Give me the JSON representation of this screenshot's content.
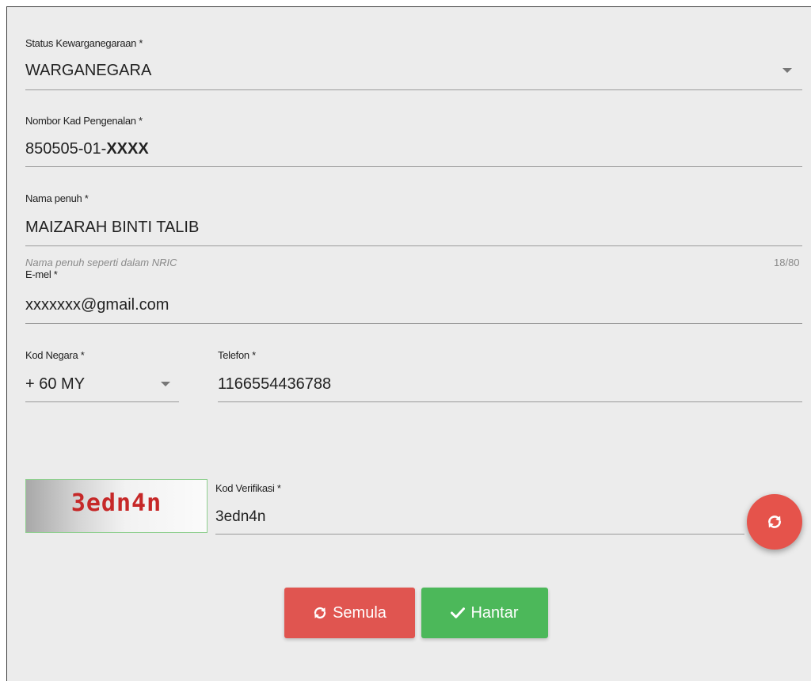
{
  "form": {
    "citizenship": {
      "label": "Status Kewarganegaraan *",
      "value": "WARGANEGARA"
    },
    "ic_number": {
      "label": "Nombor Kad Pengenalan *",
      "value_prefix": "850505-01-",
      "value_masked": "XXXX"
    },
    "full_name": {
      "label": "Nama penuh *",
      "value": "MAIZARAH BINTI TALIB",
      "hint": "Nama penuh seperti dalam NRIC",
      "counter": "18/80"
    },
    "email": {
      "label": "E-mel *",
      "value": "xxxxxxx@gmail.com"
    },
    "country_code": {
      "label": "Kod Negara *",
      "value": "+ 60 MY"
    },
    "phone": {
      "label": "Telefon *",
      "value": "1166554436788"
    },
    "captcha": {
      "image_text": "3edn4n"
    },
    "verification_code": {
      "label": "Kod Verifikasi *",
      "value": "3edn4n"
    }
  },
  "buttons": {
    "reset_label": "Semula",
    "submit_label": "Hantar"
  },
  "icons": {
    "refresh": "refresh-icon",
    "check": "check-icon",
    "dropdown": "chevron-down-icon"
  },
  "colors": {
    "reset": "#e05550",
    "submit": "#4cb85a",
    "fab": "#e5534b",
    "captcha_text": "#c62828"
  }
}
